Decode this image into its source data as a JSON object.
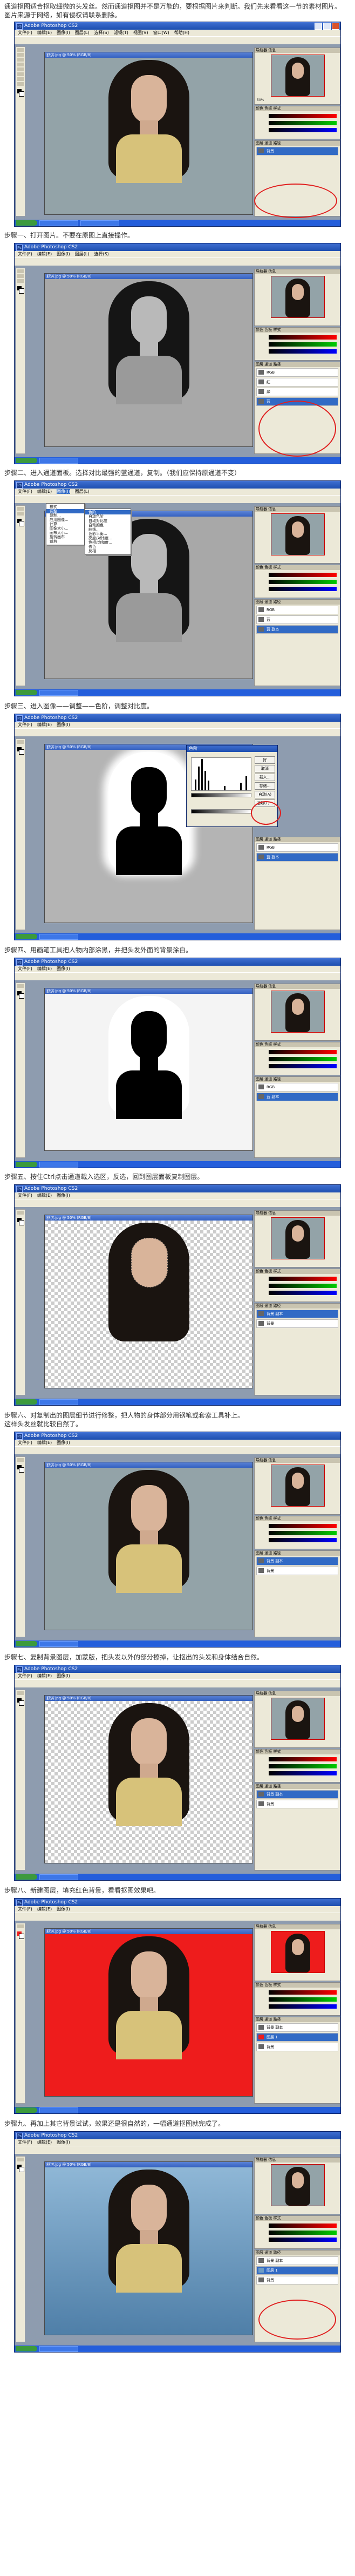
{
  "app": {
    "window_title": "Adobe Photoshop CS2",
    "doc_title": "舒淇.jpg @ 50% (RGB/8)",
    "menus": [
      "文件(F)",
      "编辑(E)",
      "图像(I)",
      "图层(L)",
      "选择(S)",
      "滤镜(T)",
      "视图(V)",
      "窗口(W)",
      "帮助(H)"
    ],
    "palette_tabs": {
      "navigator": "导航器  信息",
      "color": "颜色  色板  样式",
      "layers": "图层  通道  路径"
    },
    "zoom": "50%",
    "layer_names": [
      "RGB",
      "红",
      "绿",
      "蓝",
      "蓝 副本"
    ],
    "layer_bg": "背景",
    "layer_copy": "背景 副本",
    "layer_red_fill": "图层 1"
  },
  "steps": [
    {
      "id": "intro",
      "lines": [
        "通道抠图适合抠取细微的头发丝。然而通道抠图并不是万能的，要根据图片来判断。我们先来看看这一节的素材图片。",
        "图片来源于网络，如有侵权请联系删除。"
      ]
    },
    {
      "id": "s1",
      "lines": [
        "步骤一、打开图片。不要在原图上直接操作。"
      ]
    },
    {
      "id": "s2",
      "lines": [
        "步骤二、进入通道面板。选择对比最强的蓝通道，复制。（我们应保持原通道不变）"
      ]
    },
    {
      "id": "s3",
      "lines": [
        "步骤三、进入图像——调整——色阶，调整对比度。"
      ]
    },
    {
      "id": "s4",
      "lines": [
        "步骤四、用画笔工具把人物内部涂黑，并把头发外面的背景涂白。"
      ]
    },
    {
      "id": "s5",
      "lines": [
        "步骤五、按住Ctrl点击通道载入选区，反选，回到图层面板复制图层。"
      ]
    },
    {
      "id": "s6",
      "lines": [
        "步骤六、对复制出的图层细节进行修整，把人物的身体部分用钢笔或套索工具补上。",
        "这样头发丝就比较自然了。"
      ]
    },
    {
      "id": "s7",
      "lines": [
        "步骤七、复制背景图层，加蒙版，把头发以外的部分擦掉，让抠出的头发和身体结合自然。"
      ]
    },
    {
      "id": "s8",
      "lines": [
        "步骤八、新建图层，填充红色背景，看看抠图效果吧。"
      ]
    },
    {
      "id": "s9",
      "lines": [
        "步骤九、再加上其它背景试试，效果还是很自然的，一幅通道抠图就完成了。"
      ]
    }
  ],
  "menu_adjust": [
    "色阶...",
    "自动色阶",
    "自动对比度",
    "自动颜色",
    "曲线...",
    "色彩平衡...",
    "亮度/对比度...",
    "色相/饱和度...",
    "去色",
    "反相"
  ],
  "menu_image": [
    "模式",
    "调整",
    "复制...",
    "应用图像...",
    "计算...",
    "图像大小...",
    "画布大小...",
    "旋转画布",
    "裁剪"
  ],
  "levels_dialog": {
    "title": "色阶",
    "ok": "好",
    "cancel": "取消",
    "load": "载入...",
    "save": "存储...",
    "auto": "自动(A)",
    "options": "选项(T)..."
  },
  "colors": {
    "red_bg": "#ee1c1c",
    "ps_blue": "#1e4fb0",
    "annotation": "#e02020"
  }
}
